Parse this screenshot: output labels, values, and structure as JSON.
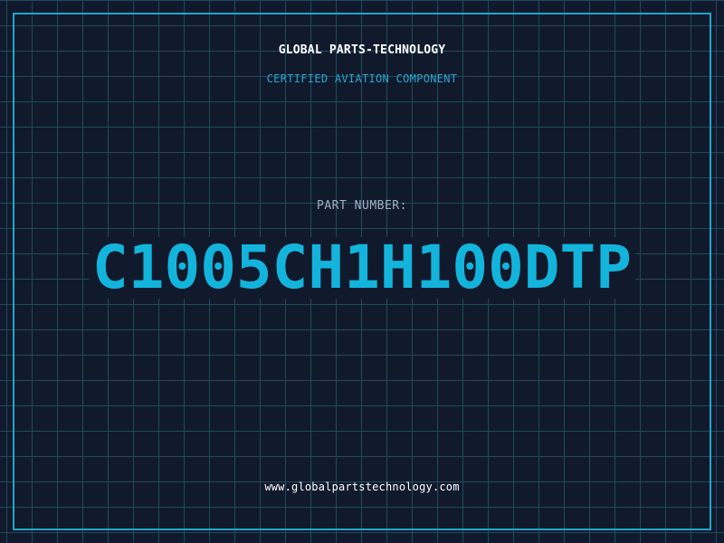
{
  "header": {
    "brand": "GLOBAL PARTS-TECHNOLOGY",
    "subtitle": "CERTIFIED AVIATION COMPONENT"
  },
  "part": {
    "label": "PART NUMBER:",
    "number": "C1005CH1H100DTP"
  },
  "footer": {
    "url": "www.globalpartstechnology.com"
  },
  "colors": {
    "background": "#111a2c",
    "grid": "#1f4a5e",
    "frame": "#1fa6c9",
    "accent": "#13b4dc",
    "brand_text": "#ffffff",
    "label_text": "#9fb0c4"
  }
}
